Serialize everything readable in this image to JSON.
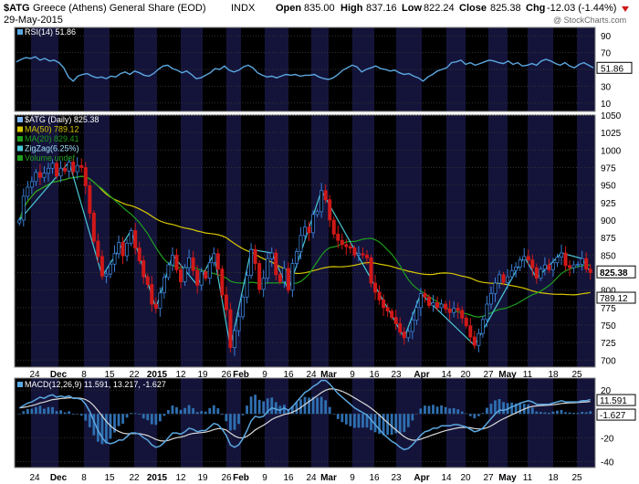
{
  "header": {
    "symbol": "$ATG",
    "name": "Greece (Athens) General Share (EOD)",
    "exchange": "INDX",
    "date": "29-May-2015",
    "open_label": "Open",
    "open": "835.00",
    "high_label": "High",
    "high": "837.16",
    "low_label": "Low",
    "low": "822.24",
    "close_label": "Close",
    "close": "825.38",
    "chg_label": "Chg",
    "chg": "-12.03 (-1.44%)",
    "watermark": "@ StockCharts.com"
  },
  "colors": {
    "panel_bg": "#000000",
    "band_bg": "#14143a",
    "price_line": "#7fb8ff",
    "up": "#3b7fd6",
    "down": "#d01818",
    "ma50": "#d8c800",
    "ma20": "#1e9e1e",
    "zigzag": "#49c9d6",
    "rsi": "#5ba7e0",
    "macd": "#5ba7e0",
    "signal": "#d8d8d8",
    "hist": "#2f6fb0"
  },
  "chart_data": [
    {
      "panel": "rsi",
      "type": "line",
      "legend": "RSI(14) 51.86",
      "ylim": [
        0,
        100
      ],
      "yticks": [
        90,
        70,
        50,
        30,
        10
      ],
      "last_value": "51.86",
      "values": [
        59,
        62,
        64,
        63,
        65,
        61,
        63,
        60,
        61,
        58,
        52,
        41,
        36,
        42,
        44,
        45,
        42,
        40,
        41,
        39,
        42,
        41,
        45,
        47,
        44,
        48,
        46,
        43,
        42,
        45,
        50,
        54,
        55,
        51,
        49,
        46,
        48,
        44,
        39,
        40,
        43,
        46,
        51,
        50,
        54,
        49,
        47,
        49,
        53,
        55,
        52,
        46,
        43,
        41,
        42,
        40,
        42,
        44,
        43,
        44,
        42,
        43,
        43,
        44,
        41,
        39,
        38,
        40,
        44,
        49,
        52,
        55,
        53,
        47,
        50,
        52,
        54,
        51,
        50,
        48,
        49,
        46,
        44,
        45,
        42,
        40,
        36,
        41,
        44,
        48,
        50,
        52,
        58,
        59,
        61,
        56,
        58,
        55,
        57,
        59,
        61,
        60,
        58,
        57,
        60,
        56,
        58,
        54,
        55,
        57,
        55,
        60,
        62,
        60,
        57,
        55,
        58,
        54,
        52,
        56,
        58,
        55,
        52
      ]
    },
    {
      "panel": "price",
      "type": "candlestick",
      "legend": [
        "$ATG (Daily) 825.38",
        "MA(50) 789.12",
        "MA(20) 829.41",
        "ZigZag(6.25%)",
        "Volume undef"
      ],
      "ylim": [
        690,
        1050
      ],
      "yticks": [
        1050,
        1025,
        1000,
        975,
        950,
        925,
        900,
        875,
        850,
        825,
        800,
        775,
        750,
        725,
        700
      ],
      "last_close": "825.38",
      "ma50_last": "789.12",
      "close": [
        900,
        934,
        947,
        955,
        968,
        961,
        967,
        974,
        981,
        963,
        974,
        970,
        983,
        969,
        978,
        975,
        949,
        910,
        870,
        848,
        820,
        823,
        837,
        852,
        868,
        849,
        867,
        885,
        860,
        842,
        819,
        808,
        780,
        774,
        796,
        818,
        836,
        850,
        829,
        812,
        832,
        846,
        828,
        807,
        826,
        817,
        839,
        852,
        830,
        793,
        772,
        718,
        742,
        762,
        790,
        821,
        858,
        838,
        801,
        817,
        845,
        853,
        822,
        812,
        831,
        800,
        838,
        855,
        878,
        890,
        882,
        908,
        912,
        942,
        929,
        900,
        880,
        871,
        865,
        862,
        860,
        850,
        852,
        850,
        846,
        810,
        797,
        786,
        775,
        770,
        761,
        752,
        740,
        732,
        741,
        757,
        775,
        795,
        790,
        778,
        782,
        775,
        780,
        773,
        768,
        774,
        771,
        760,
        749,
        733,
        721,
        738,
        758,
        780,
        795,
        810,
        822,
        811,
        819,
        828,
        833,
        843,
        848,
        843,
        832,
        817,
        830,
        836,
        829,
        839,
        847,
        853,
        835,
        832,
        836,
        837,
        845,
        830,
        825
      ]
    },
    {
      "panel": "macd",
      "type": "line",
      "legend": "MACD(12,26,9) 11.591, 13.217, -1.627",
      "ylim": [
        -45,
        30
      ],
      "yticks": [
        20,
        0,
        -20,
        -40
      ],
      "macd_last": "11.591",
      "hist_last": "-1.627",
      "macd": [
        5,
        7,
        9,
        10,
        12,
        14,
        13,
        15,
        16,
        14,
        15,
        14,
        15,
        13,
        13,
        12,
        8,
        2,
        -6,
        -14,
        -20,
        -24,
        -25,
        -24,
        -22,
        -22,
        -19,
        -16,
        -16,
        -17,
        -20,
        -22,
        -26,
        -28,
        -27,
        -24,
        -20,
        -16,
        -16,
        -17,
        -15,
        -12,
        -13,
        -15,
        -14,
        -14,
        -11,
        -8,
        -9,
        -13,
        -18,
        -26,
        -28,
        -26,
        -21,
        -14,
        -6,
        -2,
        -3,
        -2,
        2,
        5,
        4,
        3,
        5,
        3,
        6,
        10,
        14,
        18,
        20,
        23,
        25,
        28,
        28,
        25,
        21,
        17,
        14,
        11,
        8,
        5,
        3,
        1,
        -1,
        -5,
        -9,
        -13,
        -17,
        -20,
        -23,
        -25,
        -28,
        -30,
        -29,
        -26,
        -22,
        -18,
        -15,
        -14,
        -12,
        -12,
        -10,
        -10,
        -10,
        -9,
        -9,
        -10,
        -11,
        -13,
        -15,
        -14,
        -12,
        -8,
        -4,
        0,
        3,
        3,
        4,
        6,
        7,
        9,
        10,
        11,
        10,
        8,
        8,
        8,
        8,
        9,
        10,
        11,
        10,
        10,
        10,
        10,
        11,
        11,
        12
      ]
    }
  ],
  "x_axis": {
    "labels": [
      "24",
      "Dec",
      "8",
      "15",
      "22",
      "2015",
      "12",
      "19",
      "26",
      "Feb",
      "9",
      "16",
      "24",
      "Mar",
      "9",
      "16",
      "23",
      "Apr",
      "14",
      "20",
      "27",
      "May",
      "11",
      "18",
      "25"
    ],
    "bold": [
      "Dec",
      "2015",
      "Feb",
      "Mar",
      "Apr",
      "May"
    ]
  }
}
